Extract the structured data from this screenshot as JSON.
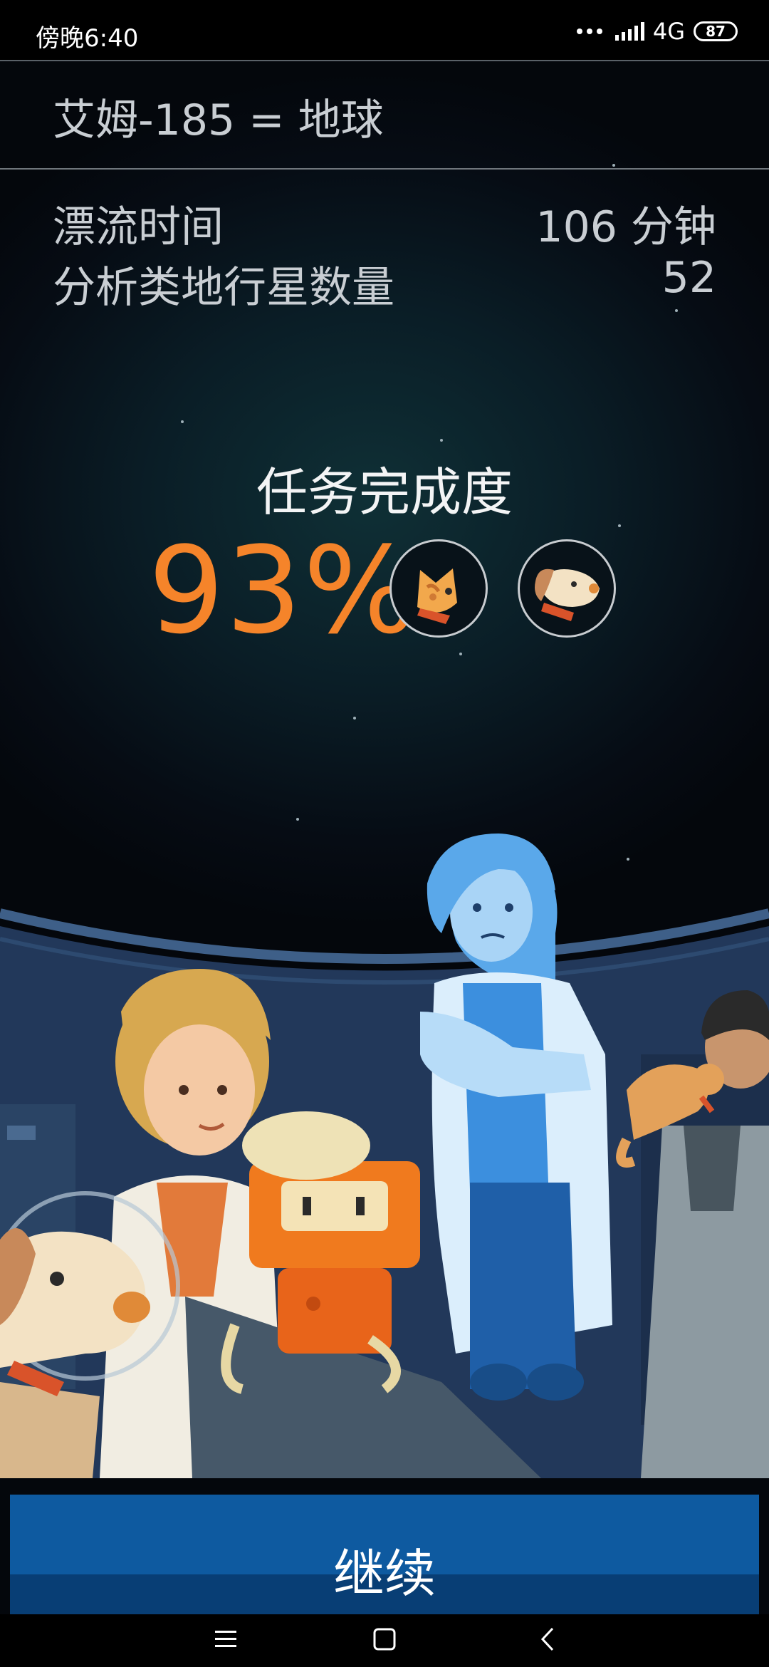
{
  "status_bar": {
    "time": "傍晚6:40",
    "network": "4G",
    "battery": "87"
  },
  "planet": {
    "title": "艾姆-185 = 地球"
  },
  "stats": [
    {
      "label": "漂流时间",
      "value": "106 分钟"
    },
    {
      "label": "分析类地行星数量",
      "value": "52"
    }
  ],
  "mission": {
    "label": "任务完成度",
    "value": "93%",
    "pets": [
      "cat-face-icon",
      "dog-face-icon"
    ]
  },
  "continue_label": "继续",
  "colors": {
    "accent": "#f5842a",
    "button": "#0e5aa0",
    "text": "#c9ced3"
  },
  "nav_icons": [
    "menu-icon",
    "home-square-icon",
    "back-chevron-icon"
  ]
}
